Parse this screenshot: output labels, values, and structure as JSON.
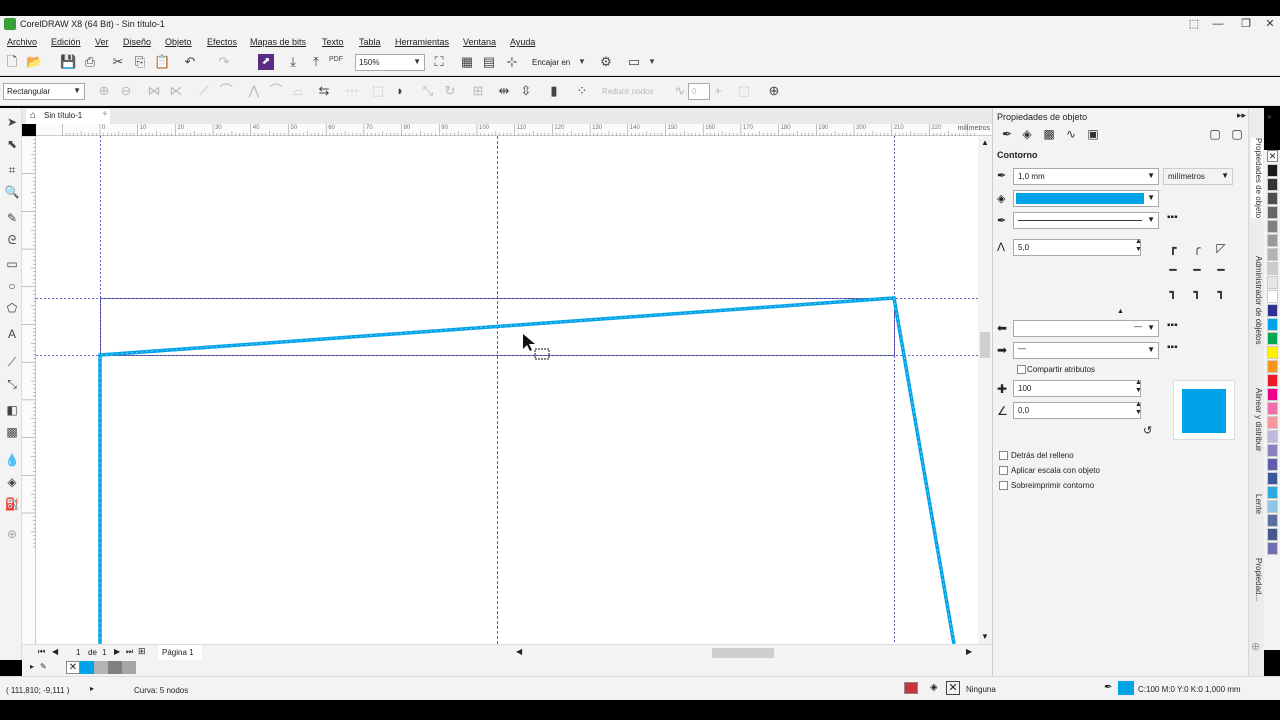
{
  "window": {
    "title": "CorelDRAW X8 (64 Bit) - Sin título-1",
    "minimize": "—",
    "restore": "❐",
    "close": "✕"
  },
  "menu": [
    "Archivo",
    "Edición",
    "Ver",
    "Diseño",
    "Objeto",
    "Efectos",
    "Mapas de bits",
    "Texto",
    "Tabla",
    "Herramientas",
    "Ventana",
    "Ayuda"
  ],
  "toolbar": {
    "zoom_value": "150%",
    "snap_label": "Encajar en",
    "pdf_label": "PDF"
  },
  "propbar": {
    "selection_mode": "Rectangular",
    "reduce_nodes": "Reducir nodos",
    "smoothing_value": "0"
  },
  "document": {
    "tab_name": "Sin título-1",
    "ruler_units": "milímetros",
    "hruler_ticks": [
      "0",
      "10",
      "20",
      "30",
      "40",
      "50",
      "60",
      "70",
      "80",
      "90",
      "100",
      "110",
      "120",
      "130",
      "140",
      "150",
      "160",
      "170",
      "180",
      "190",
      "200",
      "210",
      "220"
    ]
  },
  "pages": {
    "current": "1",
    "of_label": "de",
    "total": "1",
    "page_tab": "Página 1"
  },
  "status": {
    "coords": "( 111,810; -9,111 )",
    "object_info": "Curva: 5 nodos",
    "fill_label": "Ninguna",
    "outline_info": "C:100 M:0 Y:0 K:0  1,000 mm"
  },
  "props": {
    "header": "Propiedades de objeto",
    "section": "Contorno",
    "width_value": "1,0 mm",
    "units_value": "milímetros",
    "miter_value": "5,0",
    "share_attrs": "Compartir atributos",
    "stretch_value": "100",
    "angle_value": "0,0",
    "behind_fill": "Detrás del relleno",
    "scale_with_obj": "Aplicar escala con objeto",
    "overprint": "Sobreimprimir contorno",
    "outline_color": "#00a2e8"
  },
  "docker_tabs": [
    "Propiedades de objeto",
    "Administrador de objetos",
    "Alinear y distribuir",
    "Lente",
    "Propiedad..."
  ],
  "palette_colors": [
    "#1a1a1a",
    "#333333",
    "#4d4d4d",
    "#666666",
    "#808080",
    "#999999",
    "#b3b3b3",
    "#cccccc",
    "#e6e6e6",
    "#ffffff",
    "#2e3192",
    "#00a2e8",
    "#00a651",
    "#fff200",
    "#f7941d",
    "#ed1c24",
    "#ec008c",
    "#f06eaa",
    "#f5989d",
    "#c2b7dc",
    "#8781bd",
    "#605ca8",
    "#3b5998",
    "#29abe2",
    "#8dc6e8",
    "#5a6fa0",
    "#47578c",
    "#6f6fb1"
  ]
}
